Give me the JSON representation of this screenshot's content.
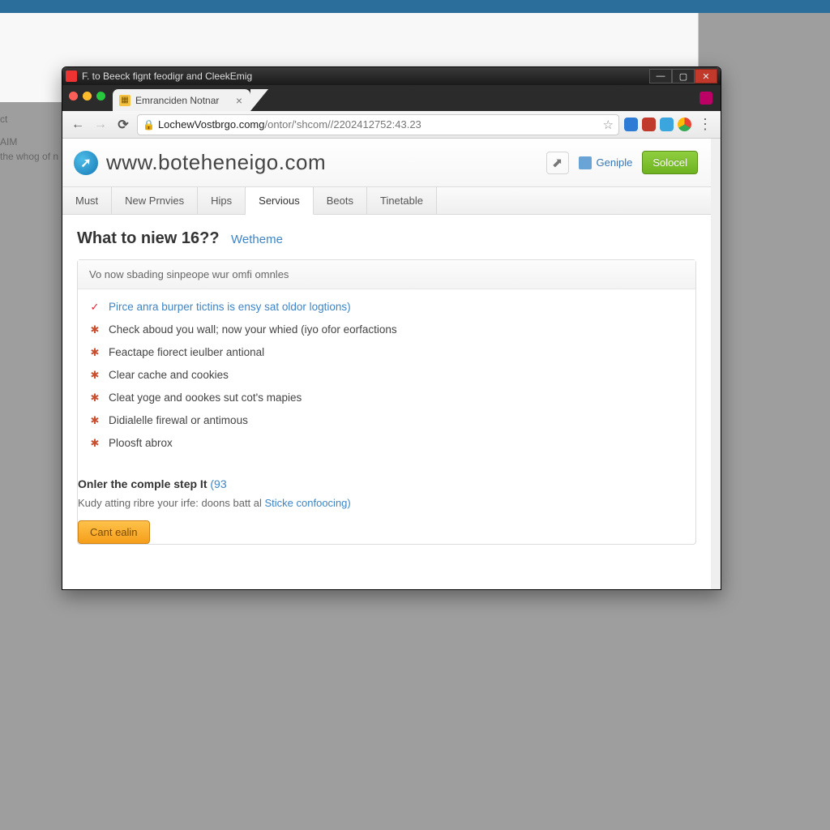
{
  "background": {
    "frag1": "ct",
    "frag2": "AIM",
    "frag3": "the whog of n"
  },
  "window": {
    "title": "F. to Beeck fignt feodigr and CleekEmig",
    "tab_label": "Emranciden Notnar",
    "url_host": "LochewVostbrgo.comg",
    "url_path": "/ontor/'shcom//2202412752:43.23"
  },
  "site": {
    "title": "www.boteheneigo.com",
    "profile": "Geniple",
    "cta": "Solocel"
  },
  "navtabs": [
    "Must",
    "New Prnvies",
    "Hips",
    "Servious",
    "Beots",
    "Tinetable"
  ],
  "nav_active_index": 3,
  "page": {
    "heading": "What to niew 16??",
    "heading_sub": "Wetheme",
    "panel_head": "Vo now sbading sinpeope wur omfi omnles",
    "steps": [
      {
        "text_pre": "Pirce anra burper tictins is ensy sat oldor ",
        "text_link": "logtions)"
      },
      {
        "text": "Check aboud you wall; now your whied (iyo ofor eorfactions"
      },
      {
        "text": "Feactape fiorect ieulber antional"
      },
      {
        "text": "Clear cache and cookies"
      },
      {
        "text": "Cleat yoge and oookes sut cot's mapies"
      },
      {
        "text": "Didialelle firewal or antimous"
      },
      {
        "text": "Ploosft abrox"
      }
    ],
    "footer_main_pre": "Onler the comple step It ",
    "footer_main_count": "(93",
    "footer_sub_pre": "Kudy atting ribre your irfe: doons batt al ",
    "footer_sub_link": "Sticke confoocing)",
    "btn": "Cant ealin"
  }
}
